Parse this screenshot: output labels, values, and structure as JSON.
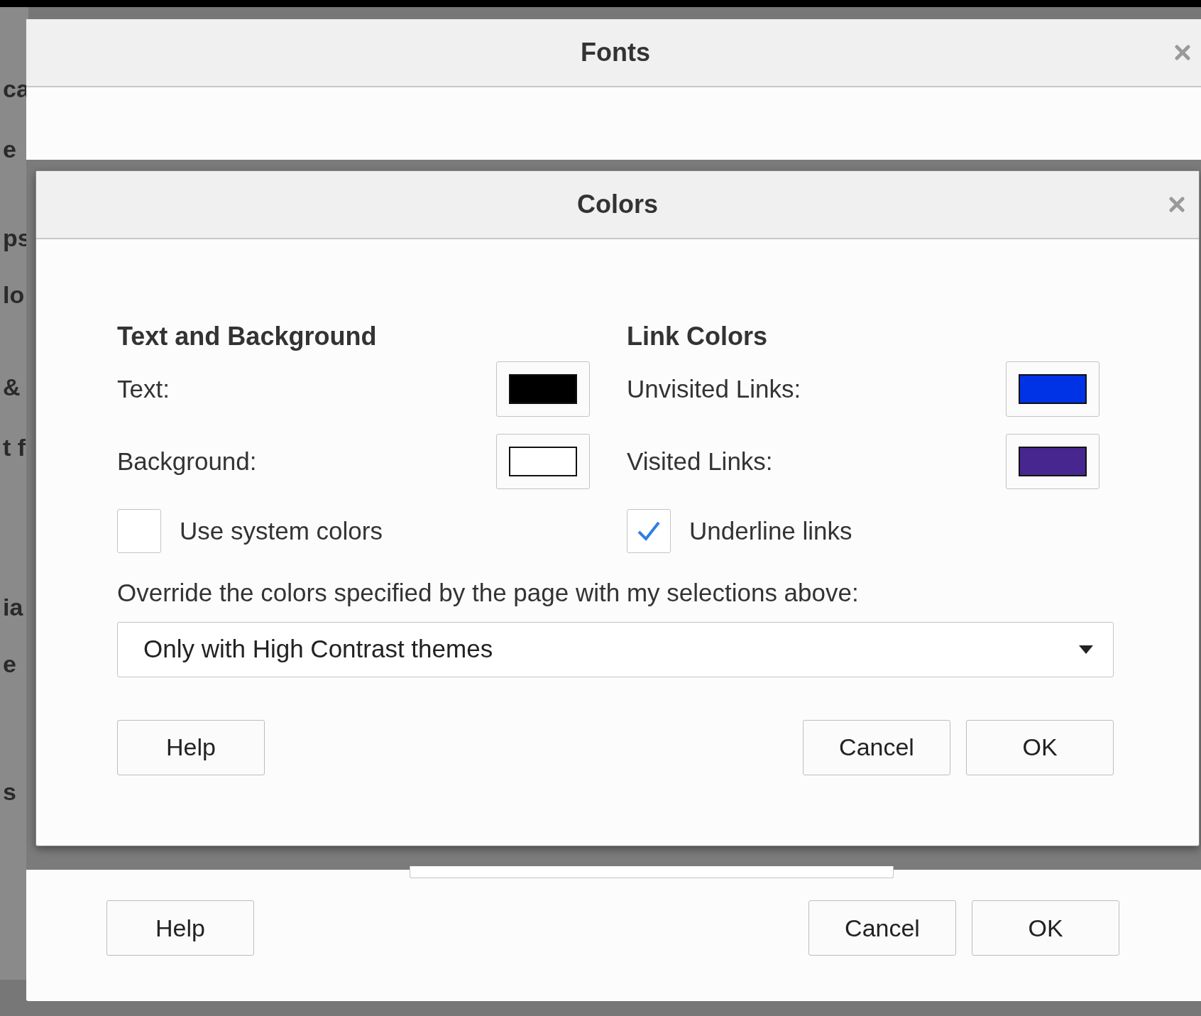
{
  "background_fragments": [
    {
      "text": "ca"
    },
    {
      "text": "e"
    },
    {
      "text": "ps"
    },
    {
      "text": "lo"
    },
    {
      "text": "&"
    },
    {
      "text": "t f"
    },
    {
      "text": "ia"
    },
    {
      "text": "e"
    },
    {
      "text": "s"
    }
  ],
  "fonts_dialog": {
    "title": "Fonts",
    "buttons": [
      {
        "label": "Help"
      },
      {
        "label": "Cancel"
      },
      {
        "label": "OK"
      }
    ]
  },
  "colors_dialog": {
    "title": "Colors",
    "text_and_background": {
      "heading": "Text and Background",
      "swatches": [
        {
          "label": "Text:",
          "color": "#000000"
        },
        {
          "label": "Background:",
          "color": "#ffffff"
        }
      ],
      "checkbox": {
        "label": "Use system colors",
        "checked": false
      }
    },
    "link_colors": {
      "heading": "Link Colors",
      "swatches": [
        {
          "label": "Unvisited Links:",
          "color": "#0033e6"
        },
        {
          "label": "Visited Links:",
          "color": "#47268f"
        }
      ],
      "checkbox": {
        "label": "Underline links",
        "checked": true
      }
    },
    "override_label": "Override the colors specified by the page with my selections above:",
    "dropdown": {
      "value": "Only with High Contrast themes"
    },
    "buttons": [
      {
        "label": "Help"
      },
      {
        "label": "Cancel"
      },
      {
        "label": "OK"
      }
    ]
  }
}
